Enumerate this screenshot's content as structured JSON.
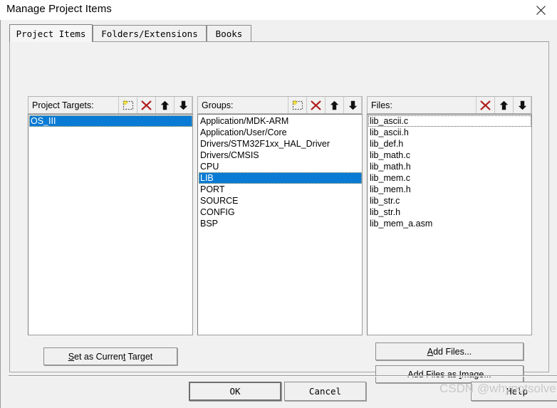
{
  "window": {
    "title": "Manage Project Items",
    "close_icon": "close-icon"
  },
  "tabs": [
    {
      "label": "Project Items",
      "active": true
    },
    {
      "label": "Folders/Extensions",
      "active": false
    },
    {
      "label": "Books",
      "active": false
    }
  ],
  "panels": {
    "project_targets": {
      "label": "Project Targets:",
      "tools": [
        {
          "name": "new-target-icon",
          "title": "New"
        },
        {
          "name": "delete-target-icon",
          "title": "Delete"
        },
        {
          "name": "move-up-icon",
          "title": "Move Up"
        },
        {
          "name": "move-down-icon",
          "title": "Move Down"
        }
      ],
      "items": [
        {
          "label": "OS_III",
          "selected": true,
          "focused": true
        }
      ]
    },
    "groups": {
      "label": "Groups:",
      "tools": [
        {
          "name": "new-group-icon",
          "title": "New"
        },
        {
          "name": "delete-group-icon",
          "title": "Delete"
        },
        {
          "name": "move-up-icon",
          "title": "Move Up"
        },
        {
          "name": "move-down-icon",
          "title": "Move Down"
        }
      ],
      "items": [
        {
          "label": "Application/MDK-ARM",
          "selected": false,
          "focused": false
        },
        {
          "label": "Application/User/Core",
          "selected": false,
          "focused": false
        },
        {
          "label": "Drivers/STM32F1xx_HAL_Driver",
          "selected": false,
          "focused": false
        },
        {
          "label": "Drivers/CMSIS",
          "selected": false,
          "focused": false
        },
        {
          "label": "CPU",
          "selected": false,
          "focused": false
        },
        {
          "label": "LIB",
          "selected": true,
          "focused": true
        },
        {
          "label": "PORT",
          "selected": false,
          "focused": false
        },
        {
          "label": "SOURCE",
          "selected": false,
          "focused": false
        },
        {
          "label": "CONFIG",
          "selected": false,
          "focused": false
        },
        {
          "label": "BSP",
          "selected": false,
          "focused": false
        }
      ]
    },
    "files": {
      "label": "Files:",
      "tools": [
        {
          "name": "delete-file-icon",
          "title": "Delete"
        },
        {
          "name": "move-up-icon",
          "title": "Move Up"
        },
        {
          "name": "move-down-icon",
          "title": "Move Down"
        }
      ],
      "items": [
        {
          "label": "lib_ascii.c",
          "selected": false,
          "focused": true
        },
        {
          "label": "lib_ascii.h",
          "selected": false,
          "focused": false
        },
        {
          "label": "lib_def.h",
          "selected": false,
          "focused": false
        },
        {
          "label": "lib_math.c",
          "selected": false,
          "focused": false
        },
        {
          "label": "lib_math.h",
          "selected": false,
          "focused": false
        },
        {
          "label": "lib_mem.c",
          "selected": false,
          "focused": false
        },
        {
          "label": "lib_mem.h",
          "selected": false,
          "focused": false
        },
        {
          "label": "lib_str.c",
          "selected": false,
          "focused": false
        },
        {
          "label": "lib_str.h",
          "selected": false,
          "focused": false
        },
        {
          "label": "lib_mem_a.asm",
          "selected": false,
          "focused": false
        }
      ]
    }
  },
  "buttons": {
    "set_current_target": {
      "pre": "",
      "accel1": "S",
      "mid": "et as Curren",
      "accel2": "t",
      "post": " Target",
      "full": "Set as Current Target"
    },
    "add_files": {
      "accel": "A",
      "rest": "dd Files...",
      "full": "Add Files..."
    },
    "add_files_as_image": {
      "pre": "Add Files as ",
      "accel": "I",
      "post": "mage...",
      "full": "Add Files as Image..."
    },
    "ok": "OK",
    "cancel": "Cancel",
    "help": "Help"
  },
  "watermark": "CSDN @whynotsolve",
  "colors": {
    "selection_blue": "#0a7bd4",
    "dialog_face": "#f0f0f0",
    "delete_red": "#b21e1e",
    "accent_yellow": "#f2e23a"
  }
}
